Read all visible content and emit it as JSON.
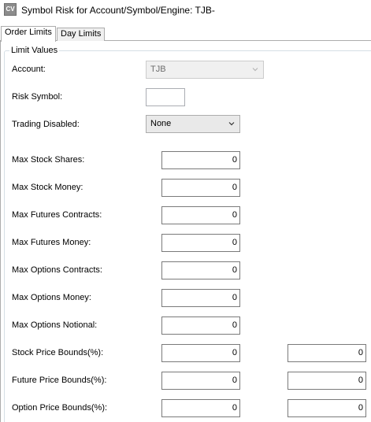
{
  "window": {
    "icon_text": "CV",
    "title": "Symbol Risk for Account/Symbol/Engine: TJB-"
  },
  "tabs": [
    {
      "label": "Order Limits",
      "active": true
    },
    {
      "label": "Day Limits",
      "active": false
    }
  ],
  "group": {
    "legend": "Limit Values"
  },
  "account": {
    "label": "Account:",
    "value": "TJB"
  },
  "risk_symbol": {
    "label": "Risk Symbol:",
    "value": ""
  },
  "trading_disabled": {
    "label": "Trading Disabled:",
    "value": "None"
  },
  "limits": [
    {
      "label": "Max Stock Shares:",
      "value": "0"
    },
    {
      "label": "Max Stock Money:",
      "value": "0"
    },
    {
      "label": "Max Futures Contracts:",
      "value": "0"
    },
    {
      "label": "Max Futures Money:",
      "value": "0"
    },
    {
      "label": "Max Options Contracts:",
      "value": "0"
    },
    {
      "label": "Max Options Money:",
      "value": "0"
    },
    {
      "label": "Max Options Notional:",
      "value": "0"
    }
  ],
  "bounds": [
    {
      "label": "Stock Price Bounds(%):",
      "lower": "0",
      "upper": "0"
    },
    {
      "label": "Future Price Bounds(%):",
      "lower": "0",
      "upper": "0"
    },
    {
      "label": "Option Price Bounds(%):",
      "lower": "0",
      "upper": "0"
    }
  ]
}
